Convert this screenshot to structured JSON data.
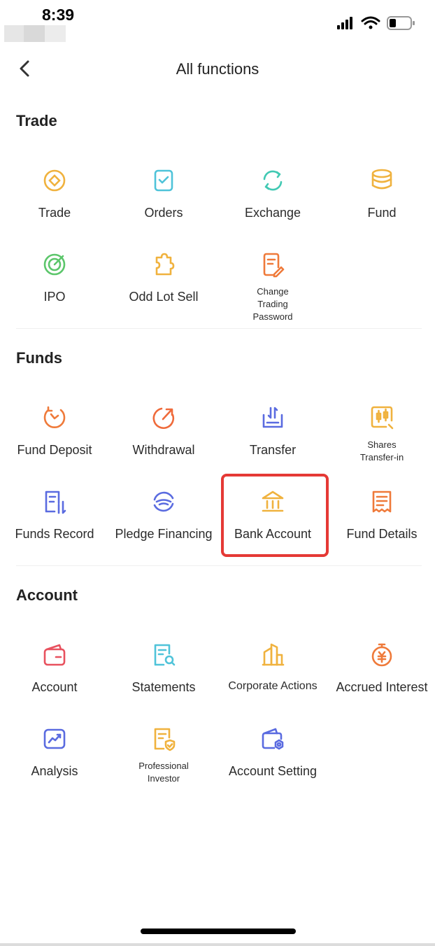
{
  "status_bar": {
    "time": "8:39",
    "icons": [
      "signal-icon",
      "wifi-icon",
      "battery-icon"
    ]
  },
  "header": {
    "title": "All functions",
    "back_icon": "chevron-left-icon"
  },
  "sections": [
    {
      "title": "Trade",
      "items": [
        {
          "label": "Trade",
          "icon": "trade-icon",
          "color": "#F0B23E"
        },
        {
          "label": "Orders",
          "icon": "orders-icon",
          "color": "#4FC3D9"
        },
        {
          "label": "Exchange",
          "icon": "exchange-icon",
          "color": "#41C9B3"
        },
        {
          "label": "Fund",
          "icon": "fund-icon",
          "color": "#F0B23E"
        },
        {
          "label": "IPO",
          "icon": "ipo-icon",
          "color": "#5CC66B"
        },
        {
          "label": "Odd Lot Sell",
          "icon": "odd-lot-icon",
          "color": "#F0B23E"
        },
        {
          "label": "Change Trading Password",
          "icon": "change-password-icon",
          "color": "#EF7A3A"
        }
      ]
    },
    {
      "title": "Funds",
      "items": [
        {
          "label": "Fund Deposit",
          "icon": "fund-deposit-icon",
          "color": "#EF7A3A"
        },
        {
          "label": "Withdrawal",
          "icon": "withdrawal-icon",
          "color": "#EF6A3A"
        },
        {
          "label": "Transfer",
          "icon": "transfer-icon",
          "color": "#5A6BE0"
        },
        {
          "label": "Shares Transfer-in",
          "icon": "shares-transfer-icon",
          "color": "#F0B23E"
        },
        {
          "label": "Funds Record",
          "icon": "funds-record-icon",
          "color": "#5A6BE0"
        },
        {
          "label": "Pledge Financing",
          "icon": "pledge-financing-icon",
          "color": "#5A6BE0"
        },
        {
          "label": "Bank Account",
          "icon": "bank-icon",
          "color": "#F0B23E"
        },
        {
          "label": "Fund Details",
          "icon": "fund-details-icon",
          "color": "#EF7A3A"
        }
      ]
    },
    {
      "title": "Account",
      "items": [
        {
          "label": "Account",
          "icon": "wallet-icon",
          "color": "#E8515E"
        },
        {
          "label": "Statements",
          "icon": "statements-icon",
          "color": "#4FC3D9"
        },
        {
          "label": "Corporate Actions",
          "icon": "corporate-actions-icon",
          "color": "#F0B23E"
        },
        {
          "label": "Accrued Interest",
          "icon": "accrued-interest-icon",
          "color": "#EF7A3A"
        },
        {
          "label": "Analysis",
          "icon": "analysis-icon",
          "color": "#5A6BE0"
        },
        {
          "label": "Professional Investor",
          "icon": "professional-investor-icon",
          "color": "#F0B23E"
        },
        {
          "label": "Account Setting",
          "icon": "account-setting-icon",
          "color": "#5A6BE0"
        }
      ]
    }
  ],
  "highlighted_item": "Bank Account",
  "highlight_color": "#E53935"
}
